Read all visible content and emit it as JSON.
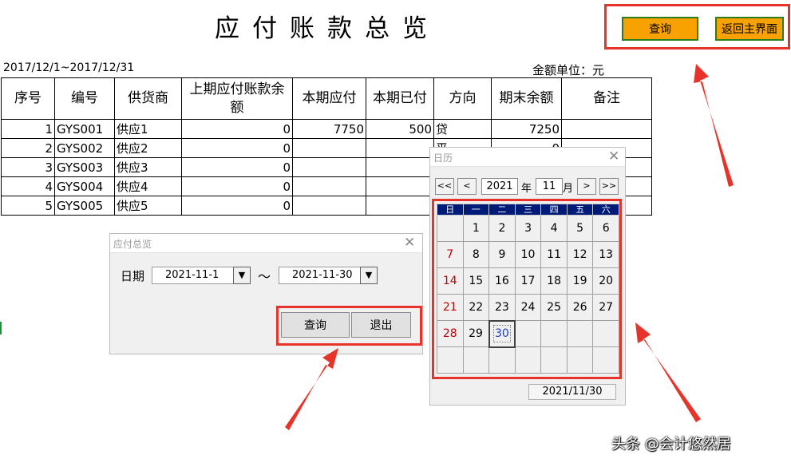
{
  "sheet": {
    "title": "应付账款总览",
    "date_range": "2017/12/1~2017/12/31",
    "amount_unit": "金额单位：元",
    "buttons": {
      "query": "查询",
      "back_main": "返回主界面"
    },
    "columns": [
      "序号",
      "编号",
      "供货商",
      "上期应付账款余额",
      "本期应付",
      "本期已付",
      "方向",
      "期末余额",
      "备注"
    ],
    "rows": [
      {
        "no": "1",
        "code": "GYS001",
        "supplier": "供应1",
        "prev_balance": "0",
        "payable": "7750",
        "paid": "500",
        "direction": "贷",
        "end_balance": "7250",
        "note": ""
      },
      {
        "no": "2",
        "code": "GYS002",
        "supplier": "供应2",
        "prev_balance": "0",
        "payable": "",
        "paid": "",
        "direction": "平",
        "end_balance": "0",
        "note": ""
      },
      {
        "no": "3",
        "code": "GYS003",
        "supplier": "供应3",
        "prev_balance": "0",
        "payable": "",
        "paid": "",
        "direction": "",
        "end_balance": "",
        "note": ""
      },
      {
        "no": "4",
        "code": "GYS004",
        "supplier": "供应4",
        "prev_balance": "0",
        "payable": "",
        "paid": "",
        "direction": "",
        "end_balance": "",
        "note": ""
      },
      {
        "no": "5",
        "code": "GYS005",
        "supplier": "供应5",
        "prev_balance": "0",
        "payable": "",
        "paid": "",
        "direction": "",
        "end_balance": "",
        "note": ""
      }
    ]
  },
  "dialog": {
    "title": "应付总览",
    "date_label": "日期",
    "start_date": "2021-11-1",
    "separator": "～",
    "end_date": "2021-11-30",
    "query_button": "查询",
    "exit_button": "退出"
  },
  "calendar": {
    "title": "日历",
    "nav": {
      "prev_year": "<<",
      "prev_month": "<",
      "next_month": ">",
      "next_year": ">>"
    },
    "year": "2021",
    "year_label": "年",
    "month": "11",
    "month_label": "月",
    "weekdays": [
      "日",
      "一",
      "二",
      "三",
      "四",
      "五",
      "六"
    ],
    "weeks": [
      [
        "",
        "1",
        "2",
        "3",
        "4",
        "5",
        "6"
      ],
      [
        "7",
        "8",
        "9",
        "10",
        "11",
        "12",
        "13"
      ],
      [
        "14",
        "15",
        "16",
        "17",
        "18",
        "19",
        "20"
      ],
      [
        "21",
        "22",
        "23",
        "24",
        "25",
        "26",
        "27"
      ],
      [
        "28",
        "29",
        "30",
        "",
        "",
        "",
        ""
      ],
      [
        "",
        "",
        "",
        "",
        "",
        "",
        ""
      ]
    ],
    "selected_day": "30",
    "status_date": "2021/11/30"
  },
  "icons": {
    "close": "close-icon",
    "dropdown": "triangle-down-icon"
  },
  "colors": {
    "highlight_frame": "#e8332a",
    "button_orange": "#f7a200",
    "weekday_header": "#001a78",
    "sunday": "#c00000"
  },
  "watermark": "头条 @会计悠然居"
}
